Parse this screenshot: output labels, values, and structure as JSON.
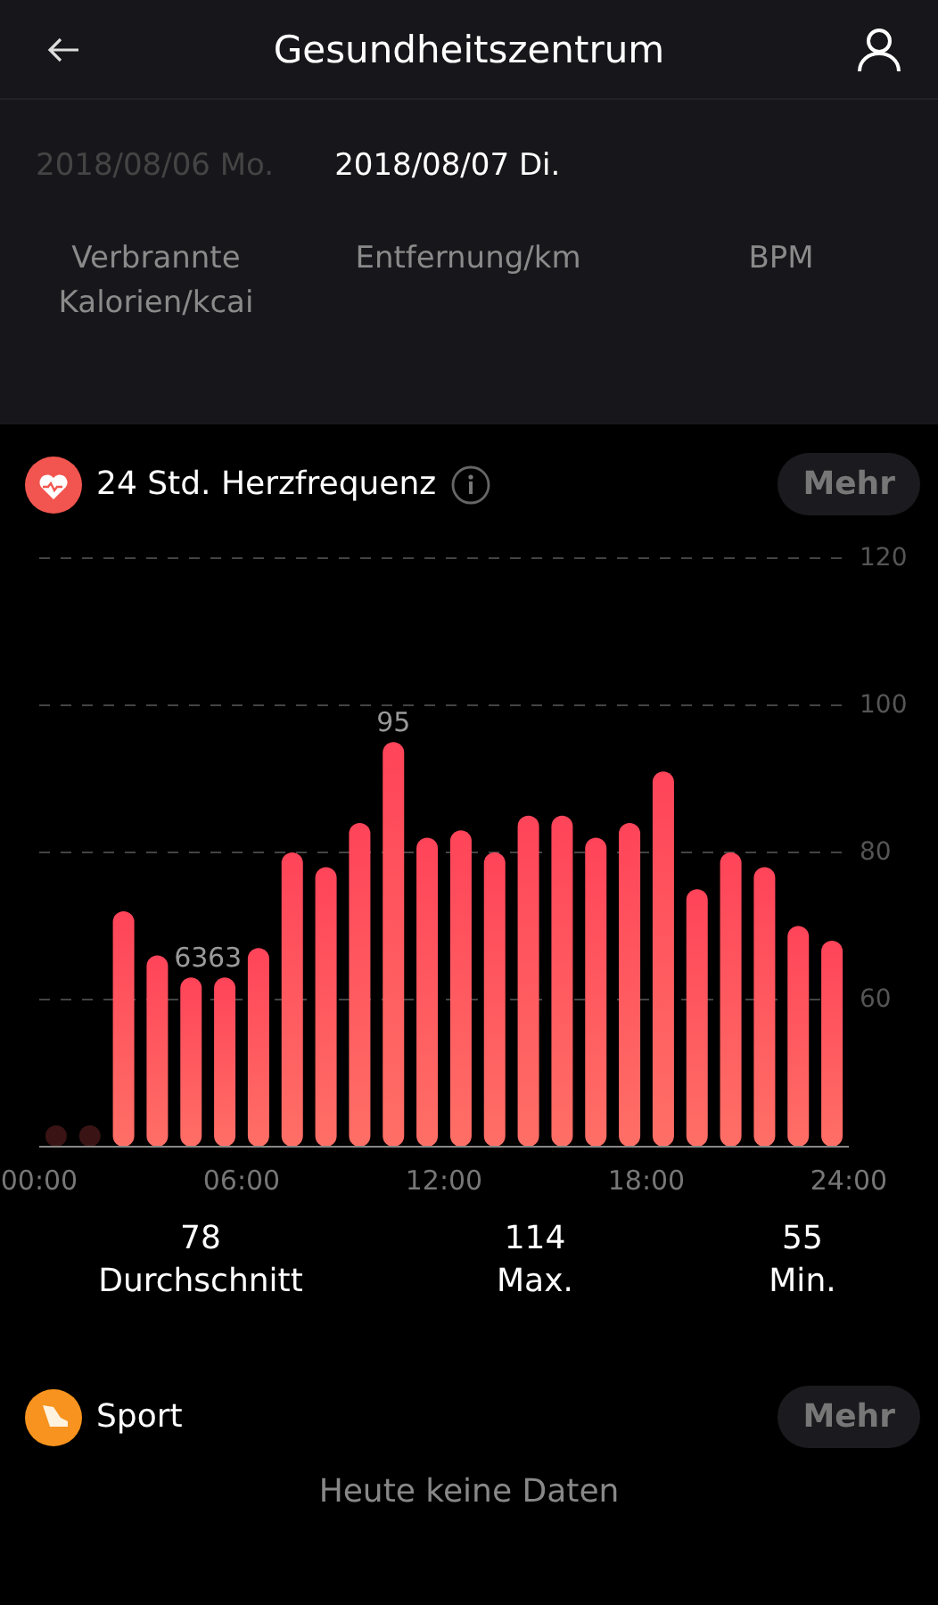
{
  "header": {
    "title": "Gesundheitszentrum"
  },
  "dates": [
    {
      "label": "2018/08/06 Mo.",
      "selected": false
    },
    {
      "label": "2018/08/07 Di.",
      "selected": true
    }
  ],
  "metrics": [
    "Verbrannte Kalorien/kcai",
    "Entfernung/km",
    "BPM"
  ],
  "heart_card": {
    "title": "24 Std. Herzfrequenz",
    "more": "Mehr",
    "chart_data": {
      "type": "bar",
      "x": [
        2.5,
        3.5,
        4.5,
        5.5,
        6.5,
        7.5,
        8.5,
        9.5,
        10.5,
        11.5,
        12.5,
        13.5,
        14.5,
        15.5,
        16.5,
        17.5,
        18.5,
        19.5,
        20.5,
        21.5,
        22.5,
        23.5
      ],
      "xlim": [
        0,
        24
      ],
      "ylim": [
        40,
        120
      ],
      "grid": true,
      "yticks": [
        60,
        80,
        100,
        120
      ],
      "xticks": [
        {
          "value": 0,
          "label": "00:00"
        },
        {
          "value": 6,
          "label": "06:00"
        },
        {
          "value": 12,
          "label": "12:00"
        },
        {
          "value": 18,
          "label": "18:00"
        },
        {
          "value": 24,
          "label": "24:00"
        }
      ],
      "values": [
        72,
        66,
        63,
        63,
        67,
        80,
        78,
        84,
        95,
        82,
        83,
        80,
        85,
        85,
        82,
        84,
        91,
        75,
        80,
        78,
        70,
        68
      ],
      "value_labels": [
        null,
        null,
        "63",
        "63",
        null,
        null,
        null,
        null,
        "95",
        null,
        null,
        null,
        null,
        null,
        null,
        null,
        null,
        null,
        null,
        null,
        null,
        null
      ]
    },
    "stats": [
      {
        "value": "78",
        "label": "Durchschnitt"
      },
      {
        "value": "114",
        "label": "Max."
      },
      {
        "value": "55",
        "label": "Min."
      }
    ]
  },
  "sport_card": {
    "title": "Sport",
    "more": "Mehr",
    "empty": "Heute keine Daten"
  }
}
